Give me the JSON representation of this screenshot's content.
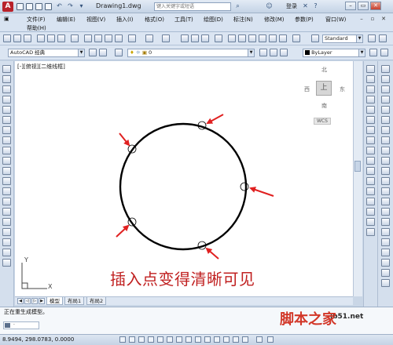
{
  "app": {
    "title": "Drawing1.dwg",
    "search_placeholder": "键入关键字或短语",
    "login_label": "登录"
  },
  "menu": {
    "items": [
      "文件(F)",
      "编辑(E)",
      "视图(V)",
      "插入(I)",
      "格式(O)",
      "工具(T)",
      "绘图(D)",
      "标注(N)",
      "修改(M)",
      "参数(P)",
      "窗口(W)"
    ],
    "help": "帮助(H)"
  },
  "toolbar": {
    "text_style": "Standard",
    "workspace": "AutoCAD 经典",
    "layer": "0",
    "color": "ByLayer"
  },
  "viewport": {
    "label": "[-][俯视][二维线框]"
  },
  "viewcube": {
    "north": "北",
    "south": "南",
    "west": "西",
    "east": "东",
    "top": "上",
    "wcs": "WCS"
  },
  "drawing": {
    "annotation": "插入点变得清晰可见",
    "ucs_x": "X",
    "ucs_y": "Y",
    "circle_color": "#000000",
    "arrow_color": "#e02020"
  },
  "tabs": {
    "model": "模型",
    "layout1": "布局1",
    "layout2": "布局2"
  },
  "command": {
    "history": "正在重生成模型。",
    "prompt": "·"
  },
  "status": {
    "coordinates": "8.9494,  298.0783, 0.0000"
  },
  "watermark": {
    "brand": "脚本之家",
    "url": "jb51.net"
  }
}
